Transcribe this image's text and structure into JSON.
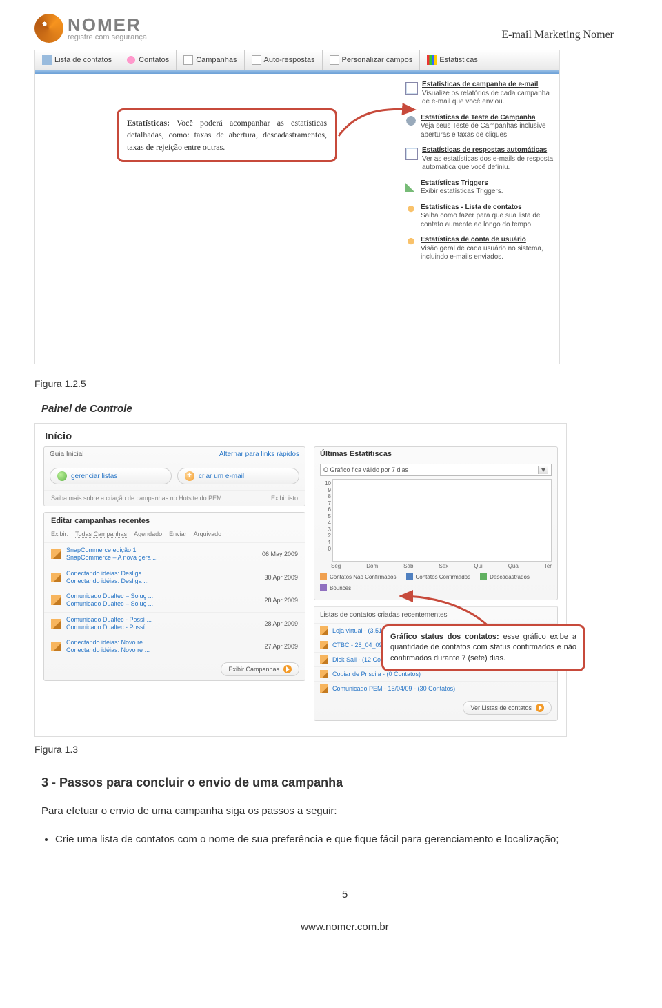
{
  "header": {
    "logo_line1": "NOMER",
    "logo_line2": "registre com segurança",
    "doc_title": "E-mail Marketing Nomer"
  },
  "tabs": {
    "t1": "Lista de contatos",
    "t2": "Contatos",
    "t3": "Campanhas",
    "t4": "Auto-respostas",
    "t5": "Personalizar campos",
    "t6": "Estatisticas"
  },
  "callout1": {
    "bold": "Estatísticas:",
    "text": " Você poderá acompanhar as estatísticas detalhadas, como: taxas de abertura, descadastramentos, taxas de rejeição entre outras."
  },
  "stat_items": [
    {
      "title": "Estatísticas de campanha de e-mail",
      "desc": "Visualize os relatórios de cada campanha de e-mail que você enviou."
    },
    {
      "title": "Estatísticas de Teste de Campanha",
      "desc": "Veja seus Teste de Campanhas inclusive aberturas e taxas de cliques."
    },
    {
      "title": "Estatísticas de respostas automáticas",
      "desc": "Ver as estatísticas dos e-mails de resposta automática que você definiu."
    },
    {
      "title": "Estatísticas Triggers",
      "desc": "Exibir estatísticas Triggers."
    },
    {
      "title": "Estatísticas - Lista de contatos",
      "desc": "Saiba como fazer para que sua lista de contato aumente ao longo do tempo."
    },
    {
      "title": "Estatísticas de conta de usuário",
      "desc": "Visão geral de cada usuário no sistema, incluindo e-mails enviados."
    }
  ],
  "fig1": "Figura 1.2.5",
  "painel_title": "Painel de Controle",
  "ss2": {
    "title": "Início",
    "guia_hdr": "Guia Inicial",
    "guia_link": "Alternar para links rápidos",
    "btn_gerenciar": "gerenciar listas",
    "btn_criar": "criar um e-mail",
    "hotsite_l": "Saiba mais sobre a criação de campanhas no Hotsite do PEM",
    "hotsite_r": "Exibir isto",
    "editar_title": "Editar campanhas recentes",
    "filter_label": "Exibir:",
    "filter_1": "Todas Campanhas",
    "filter_2": "Agendado",
    "filter_3": "Enviar",
    "filter_4": "Arquivado",
    "campanhas": [
      {
        "l1": "SnapCommerce edição 1",
        "l2": "SnapCommerce – A nova gera ...",
        "dt": "06 May 2009"
      },
      {
        "l1": "Conectando idéias: Desliga ...",
        "l2": "Conectando idéias: Desliga ...",
        "dt": "30 Apr 2009"
      },
      {
        "l1": "Comunicado Dualtec – Soluç ...",
        "l2": "Comunicado Dualtec – Soluç ...",
        "dt": "28 Apr 2009"
      },
      {
        "l1": "Comunicado Dualtec - Possí ...",
        "l2": "Comunicado Dualtec - Possí ...",
        "dt": "28 Apr 2009"
      },
      {
        "l1": "Conectando idéias: Novo re ...",
        "l2": "Conectando idéias: Novo re ...",
        "dt": "27 Apr 2009"
      }
    ],
    "exibir_camp": "Exibir Campanhas",
    "ultimas": "Últimas Estatítiscas",
    "combo": "O Gráfico fica válido por 7 dias",
    "yticks": [
      "10",
      "9",
      "8",
      "7",
      "6",
      "5",
      "4",
      "3",
      "2",
      "1",
      "0"
    ],
    "xticks": [
      "Seg",
      "Dom",
      "Sáb",
      "Sex",
      "Qui",
      "Qua",
      "Ter"
    ],
    "legend": {
      "a": "Contatos Nao Confirmados",
      "b": "Contatos Confirmados",
      "c": "Descadastrados",
      "d": "Bounces"
    },
    "listas_hdr": "Listas de contatos criadas recentementes",
    "listas": [
      "Loja virtual - (3,511 Contatos)",
      "CTBC - 28_04_09 - (14 Contatos)",
      "Dick Sail - (12 Contatos)",
      "Copiar de Priscila - (0 Contatos)",
      "Comunicado PEM - 15/04/09 - (30 Contatos)"
    ],
    "ver_listas": "Ver Listas de contatos"
  },
  "callout2": {
    "bold": "Gráfico status dos contatos:",
    "text": " esse gráfico exibe a quantidade de contatos com status confirmados e não confirmados durante 7 (sete) dias."
  },
  "chart_data": {
    "type": "bar",
    "categories": [
      "Seg",
      "Dom",
      "Sáb",
      "Sex",
      "Qui",
      "Qua",
      "Ter"
    ],
    "series": [
      {
        "name": "Contatos Nao Confirmados",
        "values": [
          0,
          0,
          0,
          0,
          0,
          0,
          0
        ]
      },
      {
        "name": "Contatos Confirmados",
        "values": [
          0,
          0,
          0,
          0,
          0,
          0,
          0
        ]
      },
      {
        "name": "Descadastrados",
        "values": [
          0,
          0,
          0,
          0,
          0,
          0,
          0
        ]
      },
      {
        "name": "Bounces",
        "values": [
          0,
          0,
          0,
          0,
          0,
          0,
          0
        ]
      }
    ],
    "ylim": [
      0,
      10
    ],
    "yticks": [
      0,
      1,
      2,
      3,
      4,
      5,
      6,
      7,
      8,
      9,
      10
    ]
  },
  "fig2": "Figura 1.3",
  "heading3": "3 - Passos para concluir o envio de uma campanha",
  "para1": "Para efetuar o envio de uma campanha siga os passos a seguir:",
  "bullet1": "Crie uma lista de contatos com o nome de sua preferência e que fique fácil para gerenciamento e localização;",
  "page_number": "5",
  "footer_url": "www.nomer.com.br"
}
